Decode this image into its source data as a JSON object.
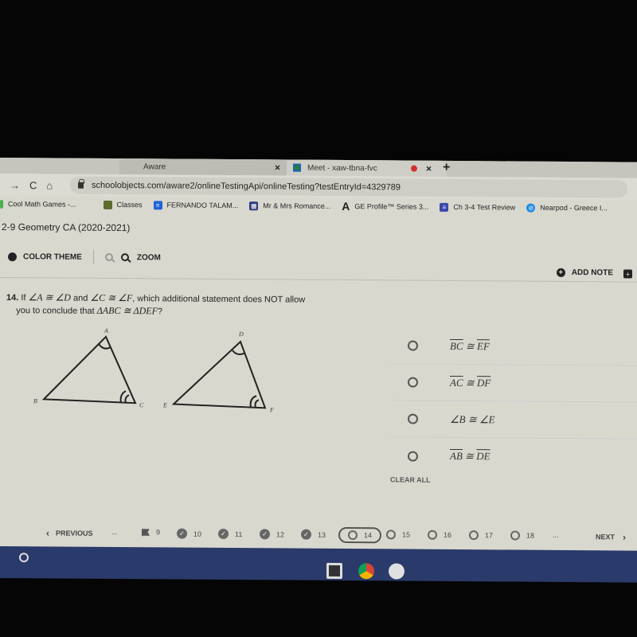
{
  "browser": {
    "tabs": [
      {
        "label": "Aware",
        "close": "×"
      },
      {
        "label": "Meet - xaw-tbna-fvc",
        "close": "×",
        "recording": true
      }
    ],
    "new_tab": "+",
    "nav": {
      "back": "←",
      "forward": "→",
      "reload": "C",
      "home": "⌂"
    },
    "url": "schoolobjects.com/aware2/onlineTestingApi/onlineTesting?testEntryId=4329789",
    "bookmarks": [
      {
        "label": "Cool Math Games -...",
        "icon_color": "#4caf50"
      },
      {
        "label": "Classes",
        "icon_color": "#5d6b2f"
      },
      {
        "label": "FERNANDO TALAM...",
        "icon_color": "#1e63d6"
      },
      {
        "label": "Mr & Mrs Romance...",
        "icon_color": "#2b3a7a"
      },
      {
        "label": "GE Profile™ Series 3...",
        "icon_glyph": "A"
      },
      {
        "label": "Ch 3-4 Test Review",
        "icon_color": "#3949ab"
      },
      {
        "label": "Nearpod - Greece I...",
        "icon_color": "#1e88e5"
      }
    ]
  },
  "app": {
    "course": "2-9 Geometry CA (2020-2021)",
    "toolbar": {
      "color_theme": "COLOR THEME",
      "zoom": "ZOOM"
    },
    "add_note": "ADD NOTE"
  },
  "question": {
    "number": "14.",
    "pre": "If",
    "a1": "∠A ≅ ∠D",
    "and": "and",
    "a2": "∠C ≅ ∠F",
    "post": ", which additional statement does NOT allow",
    "line2": "you to conclude that",
    "concl": "ΔABC ≅ ΔDEF",
    "qmark": "?",
    "figure": {
      "t1": {
        "A": "A",
        "B": "B",
        "C": "C"
      },
      "t2": {
        "D": "D",
        "E": "E",
        "F": "F"
      }
    }
  },
  "answers": [
    {
      "l": "BC",
      "op": "≅",
      "r": "EF",
      "overline": true
    },
    {
      "l": "AC",
      "op": "≅",
      "r": "DF",
      "overline": true
    },
    {
      "l": "∠B",
      "op": "≅",
      "r": "∠E",
      "overline": false
    },
    {
      "l": "AB",
      "op": "≅",
      "r": "DE",
      "overline": true
    }
  ],
  "clear_all": "CLEAR ALL",
  "pager": {
    "previous": "PREVIOUS",
    "prev_chevron": "‹",
    "ellipsis": "...",
    "items": [
      {
        "n": "9",
        "state": "flagged"
      },
      {
        "n": "10",
        "state": "answered"
      },
      {
        "n": "11",
        "state": "answered"
      },
      {
        "n": "12",
        "state": "answered"
      },
      {
        "n": "13",
        "state": "answered"
      },
      {
        "n": "14",
        "state": "current"
      },
      {
        "n": "15",
        "state": "unanswered"
      },
      {
        "n": "16",
        "state": "unanswered"
      },
      {
        "n": "17",
        "state": "unanswered"
      },
      {
        "n": "18",
        "state": "unanswered"
      }
    ],
    "next": "NEXT",
    "next_chevron": "›"
  }
}
